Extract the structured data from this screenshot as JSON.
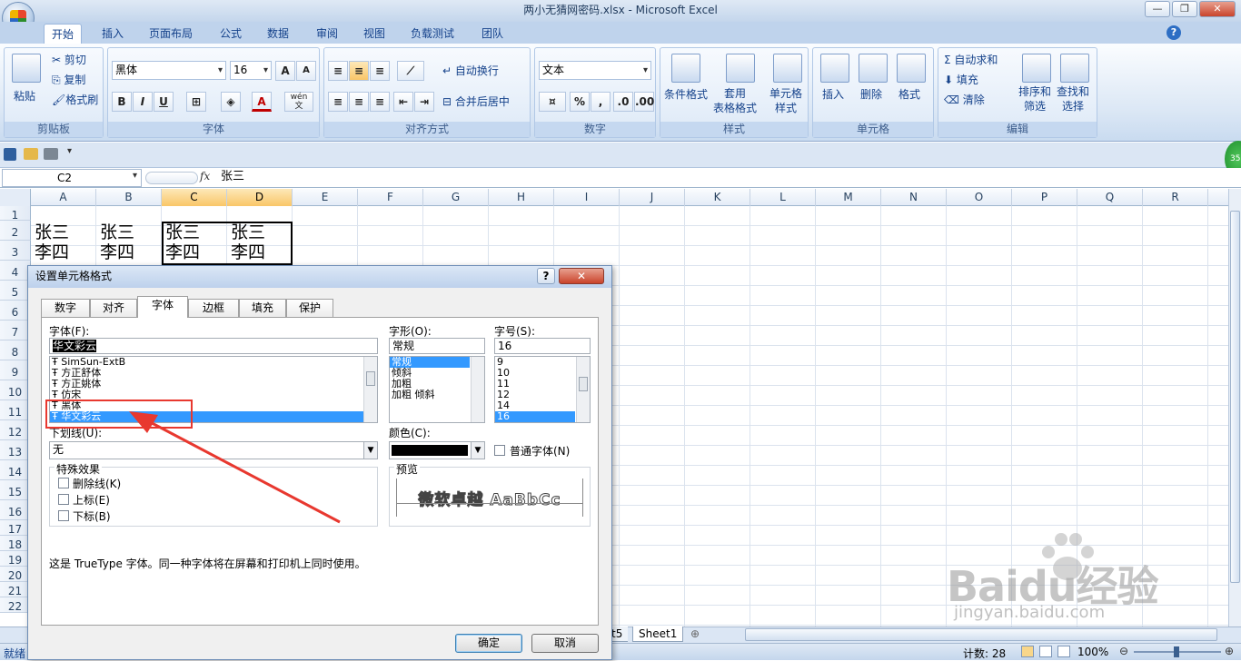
{
  "window": {
    "title": "两小无猜网密码.xlsx - Microsoft Excel",
    "minimize": "—",
    "restore": "❐",
    "close": "✕"
  },
  "ribbon": {
    "tabs": [
      "开始",
      "插入",
      "页面布局",
      "公式",
      "数据",
      "审阅",
      "视图",
      "负载测试",
      "团队"
    ],
    "clipboard": {
      "label": "剪贴板",
      "paste": "粘贴",
      "cut": "剪切",
      "copy": "复制",
      "format_painter": "格式刷"
    },
    "font": {
      "label": "字体",
      "font_name": "黑体",
      "font_size": "16",
      "grow": "A",
      "shrink": "A",
      "bold": "B",
      "italic": "I",
      "underline": "U",
      "color_a": "A",
      "wen": "wén\n文"
    },
    "alignment": {
      "label": "对齐方式",
      "wrap": "自动换行",
      "merge": "合并后居中"
    },
    "number": {
      "label": "数字",
      "format": "文本",
      "percent": "%",
      "comma": ","
    },
    "styles": {
      "label": "样式",
      "conditional": "条件格式",
      "table": "套用\n表格格式",
      "cell_styles": "单元格\n样式"
    },
    "cells": {
      "label": "单元格",
      "insert": "插入",
      "delete": "删除",
      "format": "格式"
    },
    "editing": {
      "label": "编辑",
      "autosum": "自动求和",
      "fill": "填充",
      "clear": "清除",
      "sort": "排序和\n筛选",
      "find": "查找和\n选择"
    }
  },
  "formula_bar": {
    "name_box": "C2",
    "fx": "fx",
    "content": "张三"
  },
  "columns": [
    "A",
    "B",
    "C",
    "D",
    "E",
    "F",
    "G",
    "H",
    "I",
    "J",
    "K",
    "L",
    "M",
    "N",
    "O",
    "P",
    "Q",
    "R"
  ],
  "rows": [
    "1",
    "2",
    "3",
    "4",
    "5",
    "6",
    "7",
    "8",
    "9",
    "10",
    "11",
    "12",
    "13",
    "14",
    "15",
    "16",
    "17",
    "18",
    "19",
    "20",
    "21",
    "22"
  ],
  "cells": {
    "a2": "张三",
    "b2": "张三",
    "c2": "张三",
    "d2": "张三",
    "a3": "李四",
    "b3": "李四",
    "c3": "李四",
    "d3": "李四"
  },
  "dialog": {
    "title": "设置单元格格式",
    "tabs": [
      "数字",
      "对齐",
      "字体",
      "边框",
      "填充",
      "保护"
    ],
    "font_label": "字体(F):",
    "font_value": "华文彩云",
    "font_list": [
      "SimSun-ExtB",
      "方正舒体",
      "方正姚体",
      "仿宋",
      "黑体",
      "华文彩云"
    ],
    "style_label": "字形(O):",
    "style_value": "常规",
    "style_list": [
      "常规",
      "倾斜",
      "加粗",
      "加粗 倾斜"
    ],
    "size_label": "字号(S):",
    "size_value": "16",
    "size_list": [
      "9",
      "10",
      "11",
      "12",
      "14",
      "16"
    ],
    "underline_label": "下划线(U):",
    "underline_value": "无",
    "color_label": "颜色(C):",
    "normal_font": "普通字体(N)",
    "effects_label": "特殊效果",
    "strike": "删除线(K)",
    "superscript": "上标(E)",
    "subscript": "下标(B)",
    "preview_label": "预览",
    "preview_text": "微软卓越 AaBbCc",
    "note": "这是 TrueType 字体。同一种字体将在屏幕和打印机上同时使用。",
    "ok": "确定",
    "cancel": "取消",
    "help": "?",
    "close": "✕"
  },
  "sheets": {
    "partial": "t5",
    "sheet1": "Sheet1"
  },
  "status": {
    "ready": "就绪",
    "count": "计数: 28",
    "zoom": "100%"
  },
  "watermark": {
    "brand": "Baidu经验",
    "url": "jingyan.baidu.com"
  },
  "annotation_color": "#e8382f"
}
